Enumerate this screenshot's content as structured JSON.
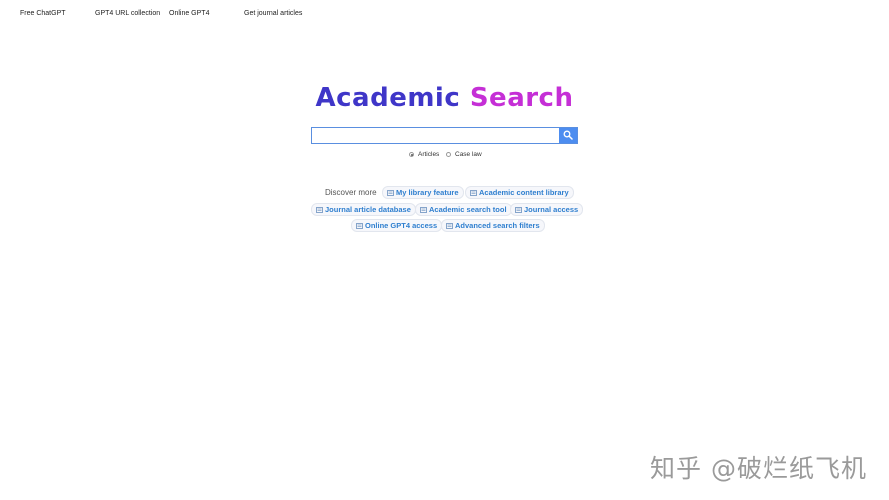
{
  "nav": {
    "links": [
      "Free ChatGPT",
      "GPT4 URL collection",
      "Online GPT4",
      "Get journal articles"
    ]
  },
  "logo": {
    "word1": "Academic",
    "word2": "Search",
    "color1": "#3f36c8",
    "color2": "#c52fd6"
  },
  "search": {
    "value": "",
    "placeholder": "",
    "button_icon": "search-icon",
    "accent": "#4d8df0"
  },
  "search_type": {
    "options": [
      "Articles",
      "Case law"
    ],
    "selected": "Articles"
  },
  "discover": {
    "label": "Discover more",
    "tag_icon": "newspaper-icon",
    "tags": [
      "My library feature",
      "Academic content library",
      "Journal article database",
      "Academic search tool",
      "Journal access",
      "Online GPT4 access",
      "Advanced search filters"
    ]
  },
  "watermark": {
    "text": "知乎 @破烂纸飞机"
  }
}
